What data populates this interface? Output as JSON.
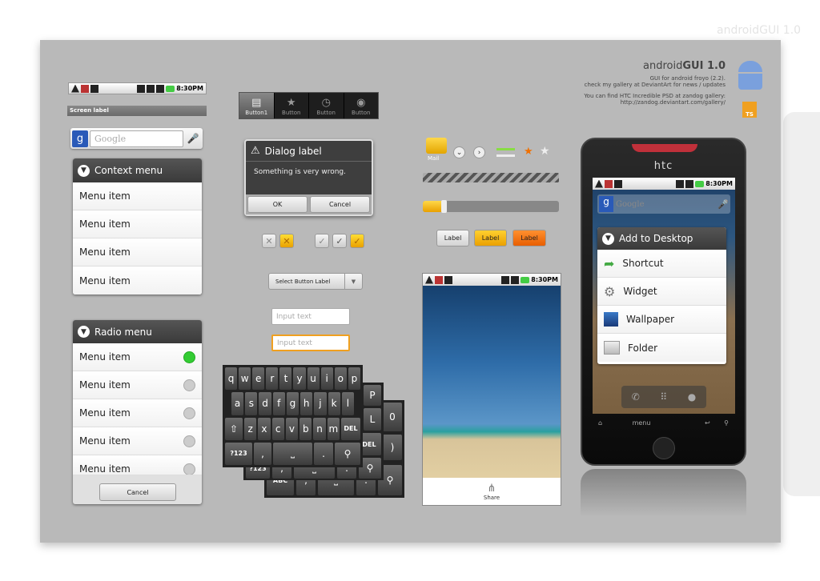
{
  "header": {
    "title_light": "android",
    "title_bold": "GUI 1.0",
    "line1": "GUI for android froyo (2.2).",
    "line2": "check my gallery at DeviantArt for news / updates",
    "line3": "You can find HTC Incredible PSD at zandog gallery:",
    "line4": "http://zandog.deviantart.com/gallery/",
    "badge": "TS"
  },
  "ghost_title": "androidGUI 1.0",
  "status_bar": {
    "time": "8:30PM"
  },
  "screen_label": "Screen label",
  "search": {
    "placeholder": "Google",
    "logo": "g"
  },
  "context_menu": {
    "title": "Context menu",
    "items": [
      "Menu item",
      "Menu item",
      "Menu item",
      "Menu item"
    ]
  },
  "radio_menu": {
    "title": "Radio menu",
    "items": [
      {
        "label": "Menu item",
        "selected": true
      },
      {
        "label": "Menu item",
        "selected": false
      },
      {
        "label": "Menu item",
        "selected": false
      },
      {
        "label": "Menu item",
        "selected": false
      },
      {
        "label": "Menu item",
        "selected": false
      }
    ],
    "cancel": "Cancel"
  },
  "tabs": [
    {
      "label": "Button1",
      "icon": "document-icon"
    },
    {
      "label": "Button",
      "icon": "bookmark-icon"
    },
    {
      "label": "Button",
      "icon": "clock-icon"
    },
    {
      "label": "Button",
      "icon": "eye-icon"
    }
  ],
  "dialog": {
    "title": "Dialog label",
    "message": "Something is very wrong.",
    "ok": "OK",
    "cancel": "Cancel"
  },
  "select": {
    "label": "Select Button Label"
  },
  "inputs": [
    {
      "placeholder": "Input text"
    },
    {
      "placeholder": "Input text"
    }
  ],
  "keyboard": {
    "row1": [
      "q",
      "w",
      "e",
      "r",
      "t",
      "y",
      "u",
      "i",
      "o",
      "p"
    ],
    "row2": [
      "a",
      "s",
      "d",
      "f",
      "g",
      "h",
      "j",
      "k",
      "l"
    ],
    "row3": [
      "z",
      "x",
      "c",
      "v",
      "b",
      "n",
      "m"
    ],
    "del": "DEL",
    "sym": "?123",
    "comma": ",",
    "period": ".",
    "abc": "ABC",
    "back_keys": [
      "P",
      "L",
      "0",
      ")"
    ]
  },
  "widgets": {
    "mail_label": "Mail",
    "progress_slider": 0.15,
    "labels": [
      "Label",
      "Label",
      "Label"
    ],
    "colors": {
      "yellow": "#f5b800",
      "orange": "#f07000",
      "green": "#88dd44"
    }
  },
  "share": {
    "label": "Share"
  },
  "phone": {
    "brand": "htc",
    "menu_title": "Add to Desktop",
    "items": [
      {
        "label": "Shortcut",
        "icon": "arrow-icon"
      },
      {
        "label": "Widget",
        "icon": "gear-icon"
      },
      {
        "label": "Wallpaper",
        "icon": "picture-icon"
      },
      {
        "label": "Folder",
        "icon": "folder-icon"
      }
    ],
    "nav_menu": "menu"
  }
}
